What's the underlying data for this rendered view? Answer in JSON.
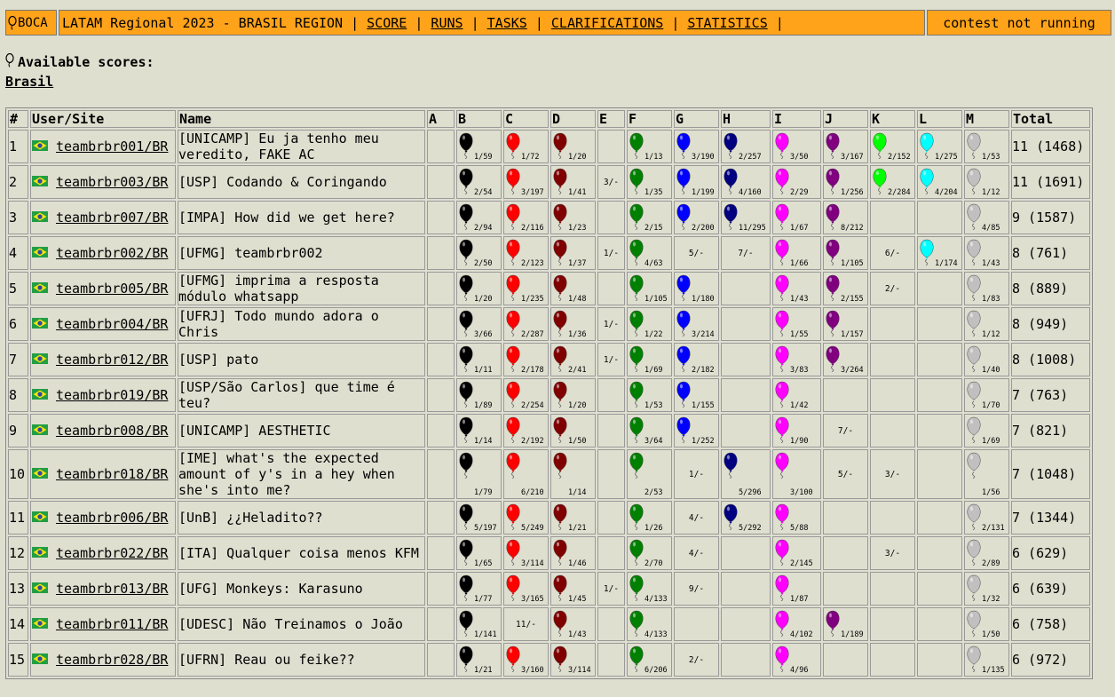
{
  "header": {
    "logo_text": "BOCA",
    "contest_title": "LATAM Regional 2023 - BRASIL REGION",
    "nav": [
      "SCORE",
      "RUNS",
      "TASKS",
      "CLARIFICATIONS",
      "STATISTICS"
    ],
    "status": "contest not running"
  },
  "available_scores_label": "Available scores:",
  "site_link": "Brasil",
  "columns": {
    "rank": "#",
    "user_site": "User/Site",
    "name": "Name",
    "problems": [
      "A",
      "B",
      "C",
      "D",
      "E",
      "F",
      "G",
      "H",
      "I",
      "J",
      "K",
      "L",
      "M"
    ],
    "total": "Total"
  },
  "balloon_colors": {
    "A": null,
    "B": "#000000",
    "C": "#ff0000",
    "D": "#800000",
    "E": null,
    "F": "#008000",
    "G": "#0000ff",
    "H": "#000080",
    "I": "#ff00ff",
    "J": "#800080",
    "K": "#00ff00",
    "L": "#00ffff",
    "M": "#c0c0c0"
  },
  "rows": [
    {
      "rank": "1",
      "user": "teambrbr001/BR",
      "name": "[UNICAMP] Eu ja tenho meu veredito, FAKE AC",
      "problems": {
        "B": {
          "s": "1/59",
          "ok": true
        },
        "C": {
          "s": "1/72",
          "ok": true
        },
        "D": {
          "s": "1/20",
          "ok": true
        },
        "F": {
          "s": "1/13",
          "ok": true
        },
        "G": {
          "s": "3/190",
          "ok": true
        },
        "H": {
          "s": "2/257",
          "ok": true
        },
        "I": {
          "s": "3/50",
          "ok": true
        },
        "J": {
          "s": "3/167",
          "ok": true
        },
        "K": {
          "s": "2/152",
          "ok": true
        },
        "L": {
          "s": "1/275",
          "ok": true
        },
        "M": {
          "s": "1/53",
          "ok": true
        }
      },
      "total": "11 (1468)"
    },
    {
      "rank": "2",
      "user": "teambrbr003/BR",
      "name": "[USP] Codando & Coringando",
      "problems": {
        "B": {
          "s": "2/54",
          "ok": true
        },
        "C": {
          "s": "3/197",
          "ok": true
        },
        "D": {
          "s": "1/41",
          "ok": true
        },
        "E": {
          "s": "3/-",
          "ok": false
        },
        "F": {
          "s": "1/35",
          "ok": true
        },
        "G": {
          "s": "1/199",
          "ok": true
        },
        "H": {
          "s": "4/160",
          "ok": true
        },
        "I": {
          "s": "2/29",
          "ok": true
        },
        "J": {
          "s": "1/256",
          "ok": true
        },
        "K": {
          "s": "2/284",
          "ok": true
        },
        "L": {
          "s": "4/204",
          "ok": true
        },
        "M": {
          "s": "1/12",
          "ok": true
        }
      },
      "total": "11 (1691)"
    },
    {
      "rank": "3",
      "user": "teambrbr007/BR",
      "name": "[IMPA] How did we get here?",
      "problems": {
        "B": {
          "s": "2/94",
          "ok": true
        },
        "C": {
          "s": "2/116",
          "ok": true
        },
        "D": {
          "s": "1/23",
          "ok": true
        },
        "F": {
          "s": "2/15",
          "ok": true
        },
        "G": {
          "s": "2/200",
          "ok": true
        },
        "H": {
          "s": "11/295",
          "ok": true
        },
        "I": {
          "s": "1/67",
          "ok": true
        },
        "J": {
          "s": "8/212",
          "ok": true
        },
        "M": {
          "s": "4/85",
          "ok": true
        }
      },
      "total": "9 (1587)"
    },
    {
      "rank": "4",
      "user": "teambrbr002/BR",
      "name": "[UFMG] teambrbr002",
      "problems": {
        "B": {
          "s": "2/50",
          "ok": true
        },
        "C": {
          "s": "2/123",
          "ok": true
        },
        "D": {
          "s": "1/37",
          "ok": true
        },
        "E": {
          "s": "1/-",
          "ok": false
        },
        "F": {
          "s": "4/63",
          "ok": true
        },
        "G": {
          "s": "5/-",
          "ok": false
        },
        "H": {
          "s": "7/-",
          "ok": false
        },
        "I": {
          "s": "1/66",
          "ok": true
        },
        "J": {
          "s": "1/105",
          "ok": true
        },
        "K": {
          "s": "6/-",
          "ok": false
        },
        "L": {
          "s": "1/174",
          "ok": true
        },
        "M": {
          "s": "1/43",
          "ok": true
        }
      },
      "total": "8 (761)"
    },
    {
      "rank": "5",
      "user": "teambrbr005/BR",
      "name": "[UFMG] imprima a resposta módulo whatsapp",
      "problems": {
        "B": {
          "s": "1/20",
          "ok": true
        },
        "C": {
          "s": "1/235",
          "ok": true
        },
        "D": {
          "s": "1/48",
          "ok": true
        },
        "F": {
          "s": "1/105",
          "ok": true
        },
        "G": {
          "s": "1/180",
          "ok": true
        },
        "I": {
          "s": "1/43",
          "ok": true
        },
        "J": {
          "s": "2/155",
          "ok": true
        },
        "K": {
          "s": "2/-",
          "ok": false
        },
        "M": {
          "s": "1/83",
          "ok": true
        }
      },
      "total": "8 (889)"
    },
    {
      "rank": "6",
      "user": "teambrbr004/BR",
      "name": "[UFRJ] Todo mundo adora o Chris",
      "problems": {
        "B": {
          "s": "3/66",
          "ok": true
        },
        "C": {
          "s": "2/287",
          "ok": true
        },
        "D": {
          "s": "1/36",
          "ok": true
        },
        "E": {
          "s": "1/-",
          "ok": false
        },
        "F": {
          "s": "1/22",
          "ok": true
        },
        "G": {
          "s": "3/214",
          "ok": true
        },
        "I": {
          "s": "1/55",
          "ok": true
        },
        "J": {
          "s": "1/157",
          "ok": true
        },
        "M": {
          "s": "1/12",
          "ok": true
        }
      },
      "total": "8 (949)"
    },
    {
      "rank": "7",
      "user": "teambrbr012/BR",
      "name": "[USP] pato",
      "problems": {
        "B": {
          "s": "1/11",
          "ok": true
        },
        "C": {
          "s": "2/178",
          "ok": true
        },
        "D": {
          "s": "2/41",
          "ok": true
        },
        "E": {
          "s": "1/-",
          "ok": false
        },
        "F": {
          "s": "1/69",
          "ok": true
        },
        "G": {
          "s": "2/182",
          "ok": true
        },
        "I": {
          "s": "3/83",
          "ok": true
        },
        "J": {
          "s": "3/264",
          "ok": true
        },
        "M": {
          "s": "1/40",
          "ok": true
        }
      },
      "total": "8 (1008)"
    },
    {
      "rank": "8",
      "user": "teambrbr019/BR",
      "name": "[USP/São Carlos] que time é teu?",
      "problems": {
        "B": {
          "s": "1/89",
          "ok": true
        },
        "C": {
          "s": "2/254",
          "ok": true
        },
        "D": {
          "s": "1/20",
          "ok": true
        },
        "F": {
          "s": "1/53",
          "ok": true
        },
        "G": {
          "s": "1/155",
          "ok": true
        },
        "I": {
          "s": "1/42",
          "ok": true
        },
        "M": {
          "s": "1/70",
          "ok": true
        }
      },
      "total": "7 (763)"
    },
    {
      "rank": "9",
      "user": "teambrbr008/BR",
      "name": "[UNICAMP] AESTHETIC",
      "problems": {
        "B": {
          "s": "1/14",
          "ok": true
        },
        "C": {
          "s": "2/192",
          "ok": true
        },
        "D": {
          "s": "1/50",
          "ok": true
        },
        "F": {
          "s": "3/64",
          "ok": true
        },
        "G": {
          "s": "1/252",
          "ok": true
        },
        "I": {
          "s": "1/90",
          "ok": true
        },
        "J": {
          "s": "7/-",
          "ok": false
        },
        "M": {
          "s": "1/69",
          "ok": true
        }
      },
      "total": "7 (821)"
    },
    {
      "rank": "10",
      "user": "teambrbr018/BR",
      "name": "[IME] what's the expected amount of y's in a hey when she's into me?",
      "problems": {
        "B": {
          "s": "1/79",
          "ok": true
        },
        "C": {
          "s": "6/210",
          "ok": true
        },
        "D": {
          "s": "1/14",
          "ok": true
        },
        "F": {
          "s": "2/53",
          "ok": true
        },
        "G": {
          "s": "1/-",
          "ok": false
        },
        "H": {
          "s": "5/296",
          "ok": true
        },
        "I": {
          "s": "3/100",
          "ok": true
        },
        "J": {
          "s": "5/-",
          "ok": false
        },
        "K": {
          "s": "3/-",
          "ok": false
        },
        "M": {
          "s": "1/56",
          "ok": true
        }
      },
      "total": "7 (1048)"
    },
    {
      "rank": "11",
      "user": "teambrbr006/BR",
      "name": "[UnB] ¿¿Heladito??",
      "problems": {
        "B": {
          "s": "5/197",
          "ok": true
        },
        "C": {
          "s": "5/249",
          "ok": true
        },
        "D": {
          "s": "1/21",
          "ok": true
        },
        "F": {
          "s": "1/26",
          "ok": true
        },
        "G": {
          "s": "4/-",
          "ok": false
        },
        "H": {
          "s": "5/292",
          "ok": true
        },
        "I": {
          "s": "5/88",
          "ok": true
        },
        "M": {
          "s": "2/131",
          "ok": true
        }
      },
      "total": "7 (1344)"
    },
    {
      "rank": "12",
      "user": "teambrbr022/BR",
      "name": "[ITA] Qualquer coisa menos KFM",
      "problems": {
        "B": {
          "s": "1/65",
          "ok": true
        },
        "C": {
          "s": "3/114",
          "ok": true
        },
        "D": {
          "s": "1/46",
          "ok": true
        },
        "F": {
          "s": "2/70",
          "ok": true
        },
        "G": {
          "s": "4/-",
          "ok": false
        },
        "I": {
          "s": "2/145",
          "ok": true
        },
        "K": {
          "s": "3/-",
          "ok": false
        },
        "M": {
          "s": "2/89",
          "ok": true
        }
      },
      "total": "6 (629)"
    },
    {
      "rank": "13",
      "user": "teambrbr013/BR",
      "name": "[UFG] Monkeys: Karasuno",
      "problems": {
        "B": {
          "s": "1/77",
          "ok": true
        },
        "C": {
          "s": "3/165",
          "ok": true
        },
        "D": {
          "s": "1/45",
          "ok": true
        },
        "E": {
          "s": "1/-",
          "ok": false
        },
        "F": {
          "s": "4/133",
          "ok": true
        },
        "G": {
          "s": "9/-",
          "ok": false
        },
        "I": {
          "s": "1/87",
          "ok": true
        },
        "M": {
          "s": "1/32",
          "ok": true
        }
      },
      "total": "6 (639)"
    },
    {
      "rank": "14",
      "user": "teambrbr011/BR",
      "name": "[UDESC] Não Treinamos o João",
      "problems": {
        "B": {
          "s": "1/141",
          "ok": true
        },
        "C": {
          "s": "11/-",
          "ok": false
        },
        "D": {
          "s": "1/43",
          "ok": true
        },
        "F": {
          "s": "4/133",
          "ok": true
        },
        "I": {
          "s": "4/102",
          "ok": true
        },
        "J": {
          "s": "1/189",
          "ok": true
        },
        "M": {
          "s": "1/50",
          "ok": true
        }
      },
      "total": "6 (758)"
    },
    {
      "rank": "15",
      "user": "teambrbr028/BR",
      "name": "[UFRN] Reau ou feike??",
      "problems": {
        "B": {
          "s": "1/21",
          "ok": true
        },
        "C": {
          "s": "3/160",
          "ok": true
        },
        "D": {
          "s": "3/114",
          "ok": true
        },
        "F": {
          "s": "6/206",
          "ok": true
        },
        "G": {
          "s": "2/-",
          "ok": false
        },
        "I": {
          "s": "4/96",
          "ok": true
        },
        "M": {
          "s": "1/135",
          "ok": true
        }
      },
      "total": "6 (972)"
    }
  ]
}
